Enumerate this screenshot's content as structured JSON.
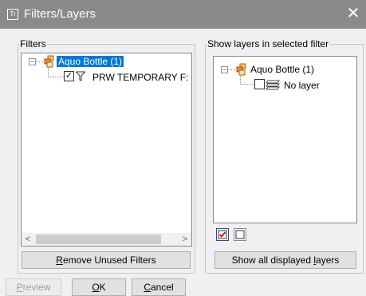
{
  "window": {
    "title": "Filters/Layers",
    "app_icon_text": "Tr",
    "close_glyph": "✕"
  },
  "filters": {
    "group_label": "Filters",
    "tree": {
      "root_label": "Aquo Bottle (1)",
      "root_expander": "−",
      "child_label": "PRW TEMPORARY F:",
      "child_checked": true
    },
    "scroll_left": "<",
    "scroll_right": ">",
    "remove_button": {
      "underline": "R",
      "rest": "emove Unused Filters"
    }
  },
  "layers": {
    "group_label": "Show layers in selected filter",
    "tree": {
      "root_label": "Aquo Bottle (1)",
      "root_expander": "−",
      "child_label": "No layer",
      "child_checked": false
    },
    "show_all_button": {
      "prefix": "Show all displayed ",
      "underline": "l",
      "suffix": "ayers"
    }
  },
  "footer": {
    "preview": {
      "underline": "P",
      "rest": "review"
    },
    "ok": {
      "underline": "O",
      "rest": "K"
    },
    "cancel": {
      "underline": "C",
      "rest": "ancel"
    }
  }
}
